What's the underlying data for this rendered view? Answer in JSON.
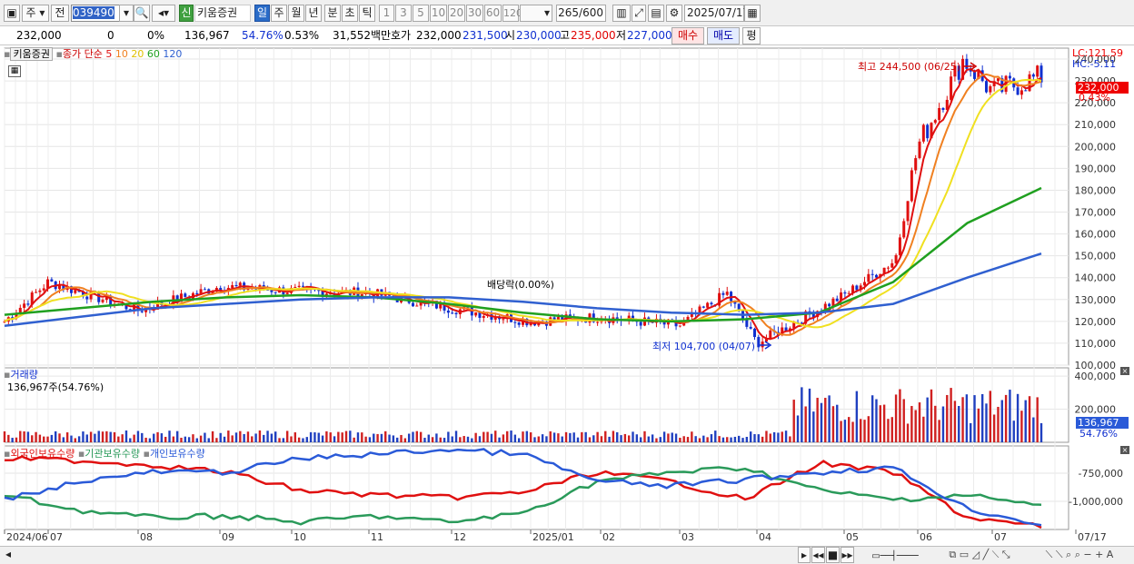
{
  "toolbar": {
    "market": "주",
    "prev": "전",
    "code": "039490",
    "stock_name": "키움증권",
    "badge": "신",
    "periods": [
      "일",
      "주",
      "월",
      "년",
      "분",
      "초",
      "틱"
    ],
    "intervals": [
      "1",
      "3",
      "5",
      "10",
      "20",
      "30",
      "60",
      "120"
    ],
    "count": "265",
    "count_total": "/600",
    "date": "2025/07/17"
  },
  "quote": {
    "price": "232,000",
    "change": "0",
    "change_pct": "0%",
    "volume": "136,967",
    "volume_pct": "54.76%",
    "turnover_pct": "0.53%",
    "amount": "31,552백만",
    "bid_label": "호가",
    "bid": "232,000",
    "ask": "231,500",
    "open_label": "시",
    "open": "230,000",
    "high_label": "고",
    "high": "235,000",
    "low_label": "저",
    "low": "227,000",
    "buy": "매수",
    "sell": "매도",
    "eval": "평"
  },
  "price_panel": {
    "stock_label": "키움증권",
    "ma_label": "종가 단순",
    "ma_periods": [
      "5",
      "10",
      "20",
      "60",
      "120"
    ],
    "ma_colors": [
      "#e01010",
      "#f08020",
      "#f0e020",
      "#20a020",
      "#3060d0"
    ],
    "lc": "LC:121.59",
    "hc": "HC:-5.11",
    "high_note": "최고 244,500 (06/25)",
    "low_note": "최저 104,700 (04/07)",
    "div_note": "배당락(0.00%)",
    "current_tag": "232,000",
    "current_pct": "0.43%"
  },
  "volume_panel": {
    "title": "거래량",
    "value": "136,967주(54.76%)",
    "tag_value": "136,967",
    "tag_pct": "54.76%"
  },
  "holdings_panel": {
    "series": [
      "외국인보유수량",
      "기관보유수량",
      "개인보유수량"
    ],
    "colors": [
      "#e01010",
      "#2a9a5a",
      "#2a5ad8"
    ]
  },
  "chart_data": [
    {
      "type": "candlestick",
      "title": "키움증권",
      "ylim": [
        100000,
        245000
      ],
      "y_ticks": [
        "240,000",
        "230,000",
        "220,000",
        "210,000",
        "200,000",
        "190,000",
        "180,000",
        "170,000",
        "160,000",
        "150,000",
        "140,000",
        "130,000",
        "120,000",
        "110,000",
        "100,000"
      ],
      "x_ticks": [
        "2024/06",
        "07",
        "08",
        "09",
        "10",
        "11",
        "12",
        "2025/01",
        "02",
        "03",
        "04",
        "05",
        "06",
        "07",
        "07/17"
      ],
      "close_points": [
        [
          "2024/06",
          120000
        ],
        [
          "07",
          138000
        ],
        [
          "08",
          125000
        ],
        [
          "09",
          136000
        ],
        [
          "10",
          134000
        ],
        [
          "11",
          133000
        ],
        [
          "12",
          126000
        ],
        [
          "2025/01",
          120000
        ],
        [
          "02",
          122000
        ],
        [
          "03",
          118000
        ],
        [
          "03-end",
          133000
        ],
        [
          "04",
          110000
        ],
        [
          "05",
          132000
        ],
        [
          "05-end",
          148000
        ],
        [
          "06",
          200000
        ],
        [
          "06-end",
          240000
        ],
        [
          "07",
          225000
        ],
        [
          "07/17",
          232000
        ]
      ],
      "ma_points": {
        "60": [
          123000,
          126000,
          129000,
          131000,
          132000,
          131000,
          128000,
          124000,
          121000,
          120000,
          121000,
          124000,
          138000,
          165000,
          181000
        ],
        "120": [
          118000,
          122000,
          126000,
          128000,
          130000,
          131000,
          131000,
          129000,
          126000,
          124000,
          123000,
          124000,
          128000,
          140000,
          151000
        ]
      }
    },
    {
      "type": "bar",
      "title": "거래량",
      "ylim": [
        0,
        450000
      ],
      "y_ticks": [
        "400,000",
        "200,000"
      ],
      "note": "volume rises sharply from 06; last value 136,967"
    },
    {
      "type": "line",
      "title": "보유수량",
      "series": [
        {
          "name": "외국인보유수량"
        },
        {
          "name": "기관보유수량"
        },
        {
          "name": "개인보유수량"
        }
      ],
      "y_ticks": [
        "-750,000",
        "-1,000,000"
      ]
    }
  ]
}
